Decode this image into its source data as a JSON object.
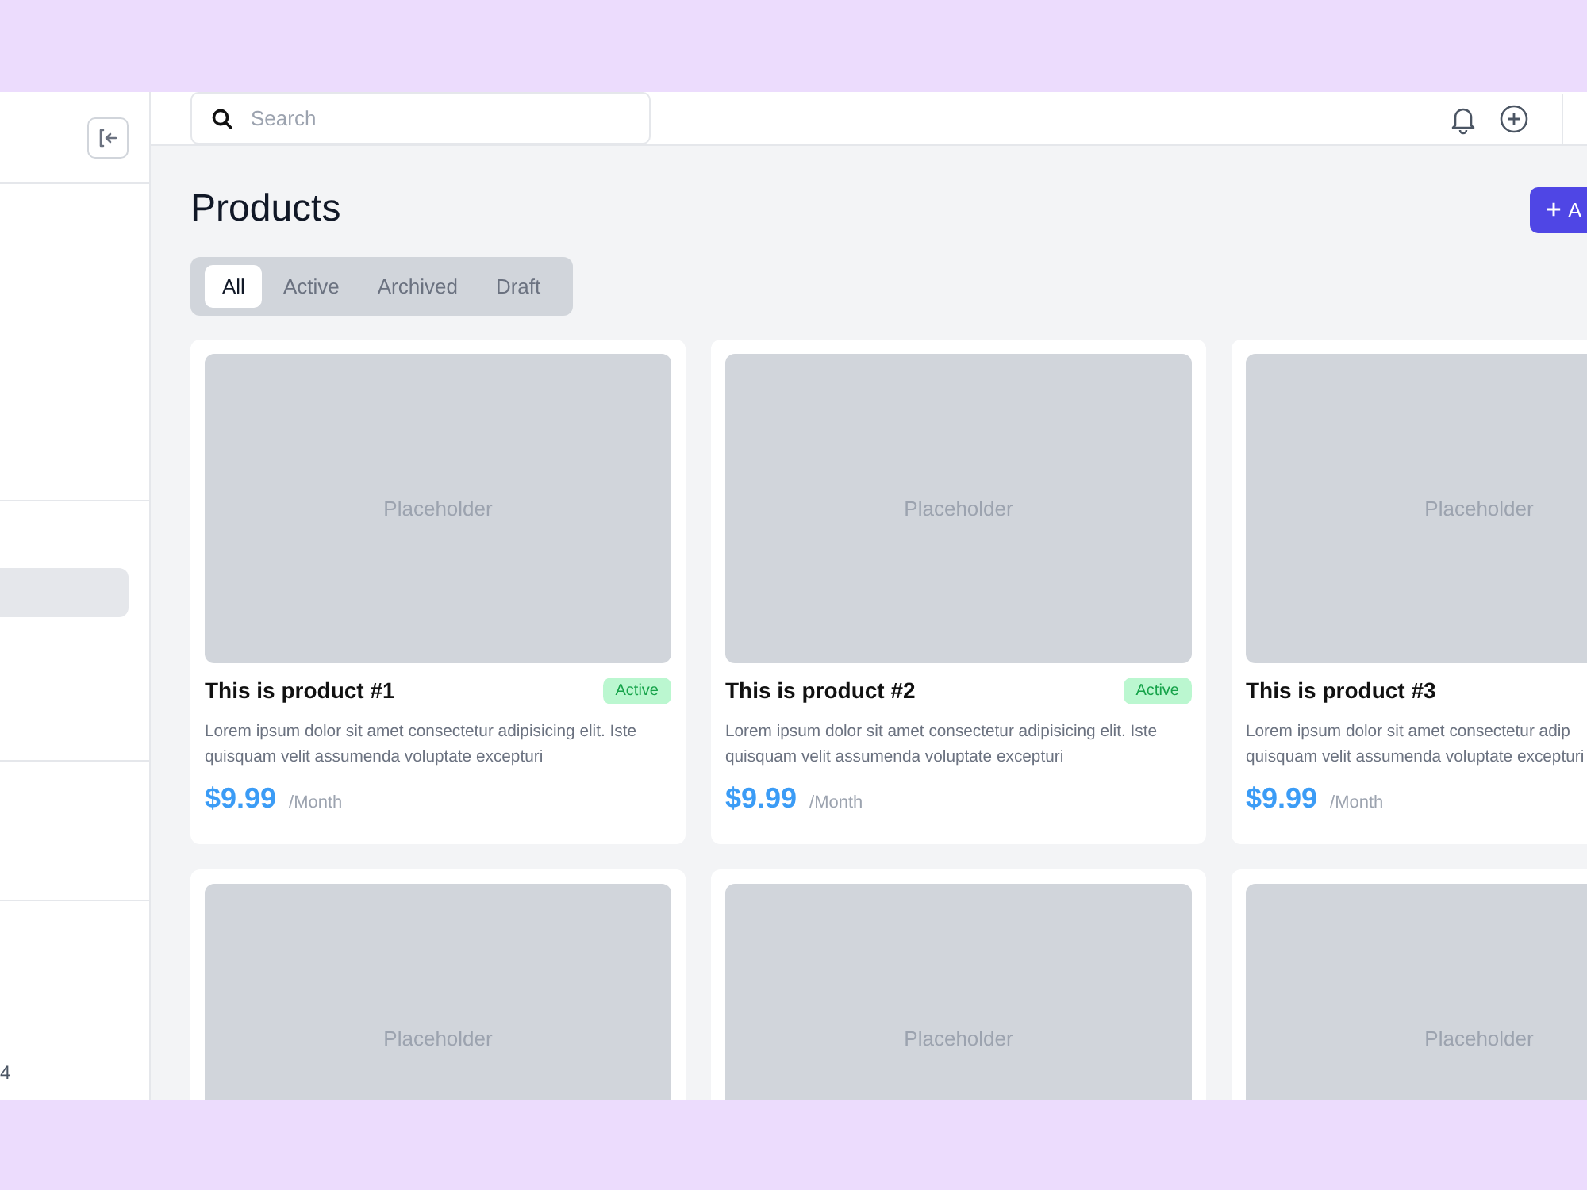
{
  "sidebar": {
    "nav_items": [
      {
        "selected": true
      }
    ],
    "footer_text": "4"
  },
  "header": {
    "search": {
      "placeholder": "Search"
    }
  },
  "page": {
    "title": "Products",
    "add_button": {
      "label": "A"
    }
  },
  "tabs": [
    {
      "label": "All",
      "selected": true
    },
    {
      "label": "Active",
      "selected": false
    },
    {
      "label": "Archived",
      "selected": false
    },
    {
      "label": "Draft",
      "selected": false
    }
  ],
  "products": [
    {
      "placeholder": "Placeholder",
      "title": "This is product #1",
      "status": "Active",
      "description_lines": [
        "Lorem ipsum dolor sit amet consectetur adipisicing elit. Iste",
        "quisquam velit assumenda voluptate excepturi"
      ],
      "price": "$9.99",
      "period": "/Month"
    },
    {
      "placeholder": "Placeholder",
      "title": "This is product #2",
      "status": "Active",
      "description_lines": [
        "Lorem ipsum dolor sit amet consectetur adipisicing elit. Iste",
        "quisquam velit assumenda voluptate excepturi"
      ],
      "price": "$9.99",
      "period": "/Month"
    },
    {
      "placeholder": "Placeholder",
      "title": "This is product #3",
      "description_lines": [
        "Lorem ipsum dolor sit amet consectetur adip",
        "quisquam velit assumenda voluptate excepturi"
      ],
      "price": "$9.99",
      "period": "/Month"
    },
    {
      "placeholder": "Placeholder"
    },
    {
      "placeholder": "Placeholder"
    },
    {
      "placeholder": "Placeholder"
    }
  ]
}
